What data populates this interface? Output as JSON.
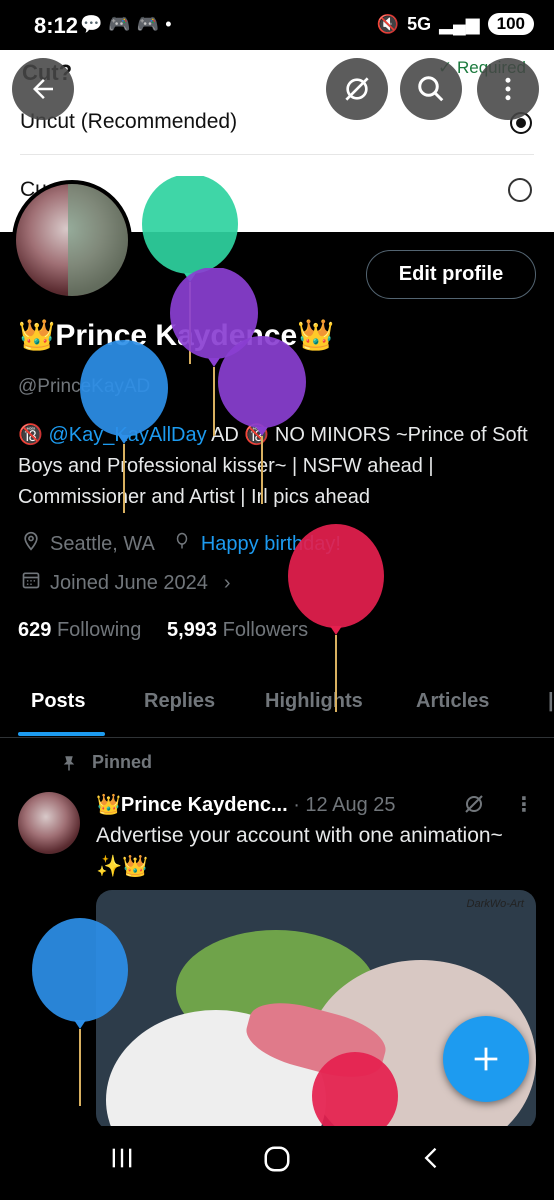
{
  "status_bar": {
    "time": "8:12",
    "network": "5G",
    "battery": "100"
  },
  "sheet": {
    "title": "Cut?",
    "required": "Required",
    "option1": "Uncut (Recommended)",
    "option2": "Cu"
  },
  "profile": {
    "display_name": "👑Prince Kaydence👑",
    "handle": "@PrinceKayAD",
    "bio_prefix": "🔞 ",
    "bio_mention": "@Kay_KayAllDay",
    "bio_rest": " AD 🔞 NO MINORS ~Prince of Soft Boys and Professional kisser~ | NSFW ahead | Commissioner and Artist | Irl pics ahead",
    "location": "Seattle, WA",
    "birthday": "Happy birthday!",
    "joined": "Joined June 2024",
    "following_count": "629",
    "following_label": "Following",
    "followers_count": "5,993",
    "followers_label": "Followers",
    "edit_profile": "Edit profile"
  },
  "tabs": [
    "Posts",
    "Replies",
    "Highlights",
    "Articles"
  ],
  "post": {
    "pinned": "Pinned",
    "author": "👑Prince Kaydenc...",
    "date": "· 12 Aug 25",
    "text": "Advertise your account with one animation~ ✨👑",
    "watermark": "DarkWo-Art"
  },
  "colors": {
    "accent": "#1d9bf0",
    "background": "#000000",
    "muted": "#71767b"
  },
  "icons": [
    "back-arrow-icon",
    "no-sync-icon",
    "search-icon",
    "more-vertical-icon",
    "location-icon",
    "balloon-icon",
    "calendar-icon",
    "pin-icon",
    "plus-icon"
  ]
}
